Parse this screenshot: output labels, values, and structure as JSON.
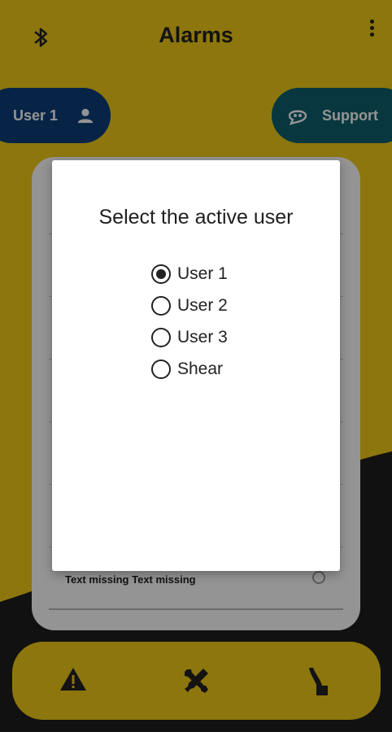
{
  "header": {
    "title": "Alarms"
  },
  "user_pill": {
    "label": "User 1"
  },
  "support_pill": {
    "label": "Support"
  },
  "list": {
    "row_text": "Text missing Text missing"
  },
  "dialog": {
    "title": "Select the active user",
    "options": [
      {
        "label": "User 1",
        "selected": true
      },
      {
        "label": "User 2",
        "selected": false
      },
      {
        "label": "User 3",
        "selected": false
      },
      {
        "label": "Shear",
        "selected": false
      }
    ]
  },
  "colors": {
    "background_yellow": "#f2cc17",
    "user_pill": "#0d3f7a",
    "support_pill": "#0e5f6d"
  },
  "icons": {
    "top_left": "bluetooth-icon",
    "top_right": "more-vert-icon",
    "user": "person-icon",
    "support": "support-chat-icon",
    "nav": [
      "warning-icon",
      "tools-icon",
      "hook-icon"
    ]
  }
}
